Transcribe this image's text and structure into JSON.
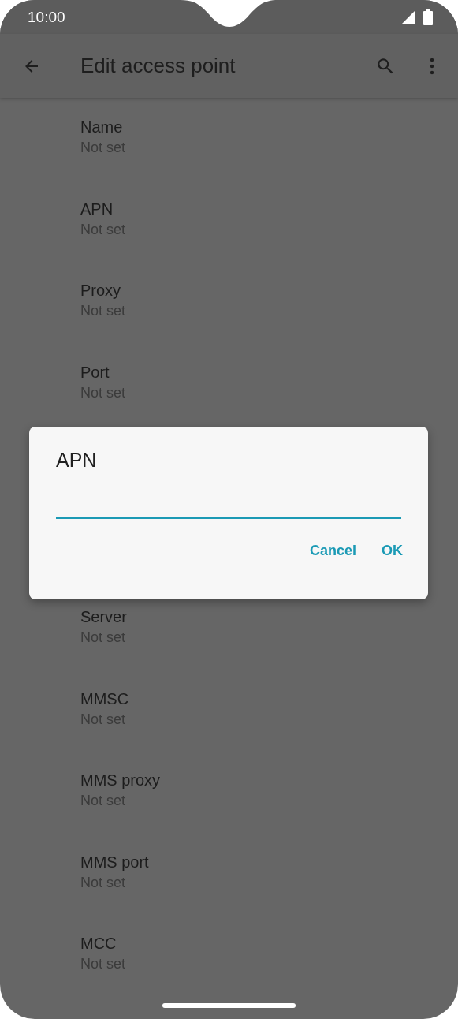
{
  "status_bar": {
    "time": "10:00"
  },
  "app_bar": {
    "title": "Edit access point"
  },
  "settings": [
    {
      "title": "Name",
      "summary": "Not set"
    },
    {
      "title": "APN",
      "summary": "Not set"
    },
    {
      "title": "Proxy",
      "summary": "Not set"
    },
    {
      "title": "Port",
      "summary": "Not set"
    },
    {
      "title": "Server",
      "summary": "Not set"
    },
    {
      "title": "MMSC",
      "summary": "Not set"
    },
    {
      "title": "MMS proxy",
      "summary": "Not set"
    },
    {
      "title": "MMS port",
      "summary": "Not set"
    },
    {
      "title": "MCC",
      "summary": "Not set"
    }
  ],
  "dialog": {
    "title": "APN",
    "buttons": [
      "Cancel",
      "OK"
    ]
  }
}
